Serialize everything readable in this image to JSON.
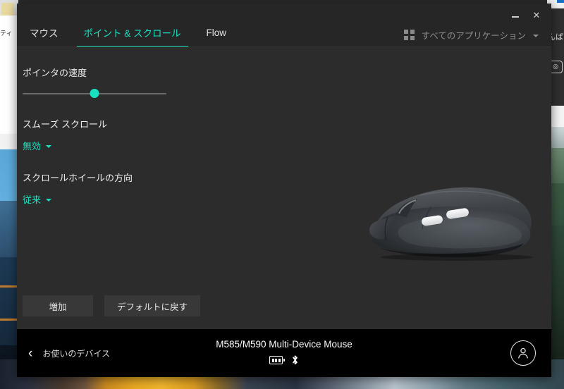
{
  "window": {
    "minimize_label": "–",
    "close_label": "✕"
  },
  "tabs": [
    {
      "label": "マウス",
      "active": false
    },
    {
      "label": "ポイント & スクロール",
      "active": true
    },
    {
      "label": "Flow",
      "active": false
    }
  ],
  "apps_filter": {
    "icon": "grid-icon",
    "label": "すべてのアプリケーション",
    "chevron": "chevron-down-icon"
  },
  "settings": {
    "pointer_speed": {
      "title": "ポインタの速度",
      "value_percent": 50
    },
    "smooth_scroll": {
      "title": "スムーズ スクロール",
      "value": "無効"
    },
    "scroll_direction": {
      "title": "スクロールホイールの方向",
      "value": "従来"
    }
  },
  "actions": {
    "add_label": "増加",
    "reset_label": "デフォルトに戻す"
  },
  "device_bar": {
    "back_icon": "‹",
    "back_label": "お使いのデバイス",
    "device_name": "M585/M590 Multi-Device Mouse",
    "battery_icon": "battery-icon",
    "bluetooth_icon": "bluetooth-icon",
    "account_icon": "account-avatar-icon"
  },
  "desktop": {
    "left_browser_text": "ティ",
    "right_browser_text": "んば",
    "right_browser_chip": "◎"
  },
  "colors": {
    "accent": "#18e0c0",
    "window_bg": "#2c2c2c",
    "titlebar_bg": "#262626",
    "devicebar_bg": "#000000",
    "button_bg": "#383838"
  }
}
